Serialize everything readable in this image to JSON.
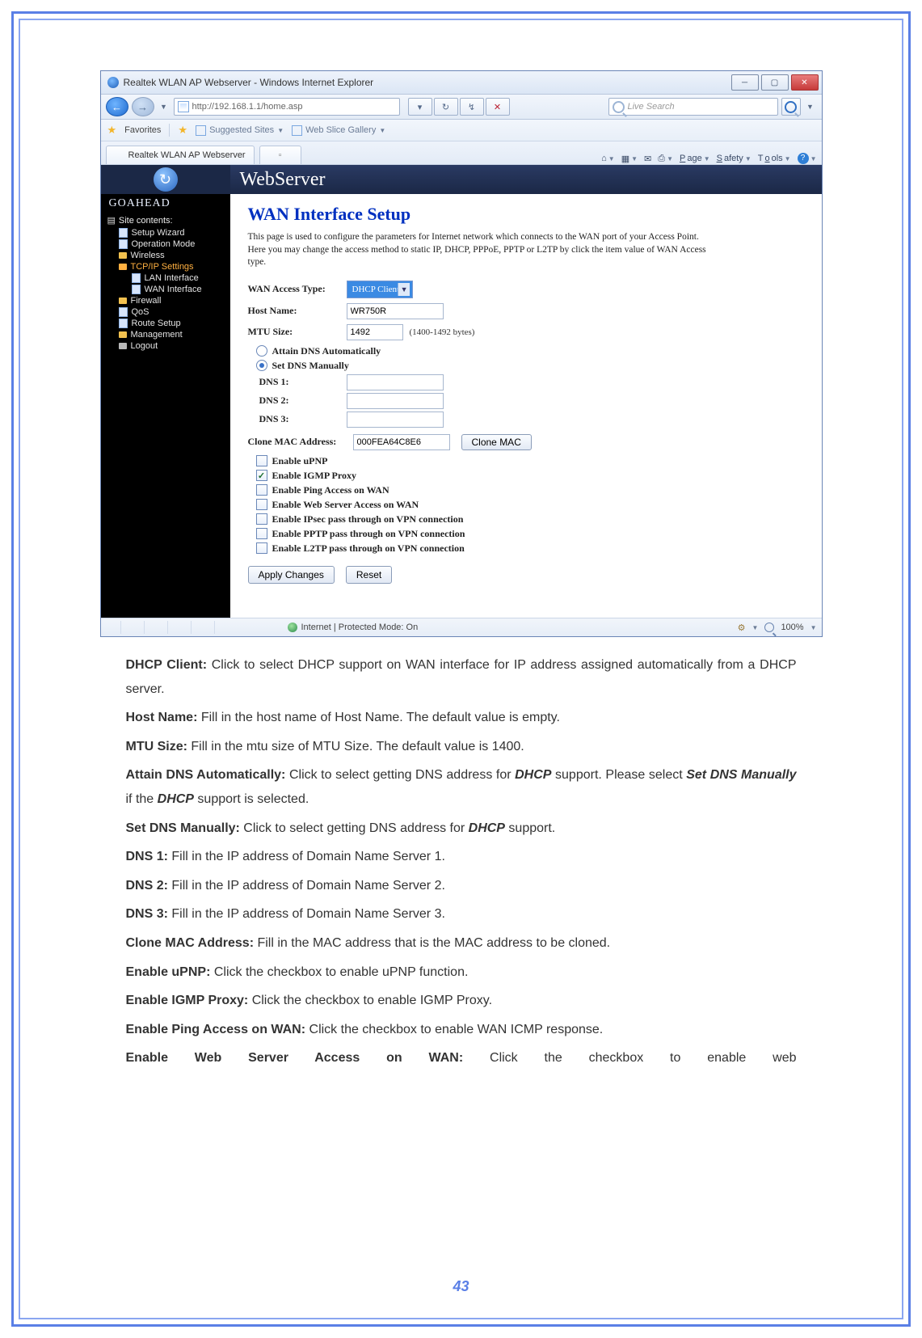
{
  "window": {
    "title": "Realtek WLAN AP Webserver - Windows Internet Explorer",
    "min_label": "─",
    "max_label": "▢",
    "close_label": "✕"
  },
  "addressbar": {
    "url": "http://192.168.1.1/home.asp",
    "search_placeholder": "Live Search"
  },
  "favbar": {
    "favorites": "Favorites",
    "suggested": "Suggested Sites",
    "webslice": "Web Slice Gallery"
  },
  "tabs": {
    "active": "Realtek WLAN AP Webserver"
  },
  "cmd": {
    "page": "Page",
    "safety": "Safety",
    "tools": "Tools"
  },
  "brand": {
    "webserver": "WebServer",
    "goahead": "GOAHEAD"
  },
  "sidebar": {
    "title": "Site contents:",
    "items": {
      "setup_wizard": "Setup Wizard",
      "operation_mode": "Operation Mode",
      "wireless": "Wireless",
      "tcpip": "TCP/IP Settings",
      "lan": "LAN Interface",
      "wan": "WAN Interface",
      "firewall": "Firewall",
      "qos": "QoS",
      "route": "Route Setup",
      "management": "Management",
      "logout": "Logout"
    }
  },
  "form": {
    "heading": "WAN Interface Setup",
    "description": "This page is used to configure the parameters for Internet network which connects to the WAN port of your Access Point. Here you may change the access method to static IP, DHCP, PPPoE, PPTP or L2TP by click the item value of WAN Access type.",
    "labels": {
      "wan_access_type": "WAN Access Type:",
      "host_name": "Host Name:",
      "mtu_size": "MTU Size:",
      "mtu_hint": "(1400-1492 bytes)",
      "attain_dns": "Attain DNS Automatically",
      "set_dns": "Set DNS Manually",
      "dns1": "DNS 1:",
      "dns2": "DNS 2:",
      "dns3": "DNS 3:",
      "clone_mac": "Clone MAC Address:",
      "clone_btn": "Clone MAC",
      "enable_upnp": "Enable uPNP",
      "enable_igmp": "Enable IGMP Proxy",
      "enable_ping": "Enable Ping Access on WAN",
      "enable_web": "Enable Web Server Access on WAN",
      "enable_ipsec": "Enable IPsec pass through on VPN connection",
      "enable_pptp": "Enable PPTP pass through on VPN connection",
      "enable_l2tp": "Enable L2TP pass through on VPN connection",
      "apply": "Apply Changes",
      "reset": "Reset"
    },
    "values": {
      "wan_access_type": "DHCP Client",
      "host_name": "WR750R",
      "mtu_size": "1492",
      "dns1": "",
      "dns2": "",
      "dns3": "",
      "clone_mac": "000FEA64C8E6",
      "igmp_checked": true,
      "dns_mode": "manual"
    }
  },
  "status": {
    "mode": "Internet | Protected Mode: On",
    "zoom": "100%"
  },
  "doc": {
    "p1a": "DHCP Client:",
    "p1b": " Click to select DHCP support on WAN interface for IP address assigned automatically from a DHCP server.",
    "p2a": "Host Name:",
    "p2b": " Fill in the host name of Host Name. The default value is empty.",
    "p3a": "MTU Size:",
    "p3b": " Fill in the mtu size of MTU Size. The default value is 1400.",
    "p4a": "Attain DNS Automatically:",
    "p4b_1": " Click to select getting DNS address for ",
    "p4b_dhcp": "DHCP",
    "p4b_2": " support. Please select ",
    "p4b_set": "Set DNS Manually",
    "p4b_3": " if the ",
    "p4b_dhcp2": "DHCP",
    "p4b_4": " support is selected.",
    "p5a": "Set DNS Manually:",
    "p5b_1": " Click to select getting DNS address for ",
    "p5b_dhcp": "DHCP",
    "p5b_2": " support.",
    "p6a": "DNS 1:",
    "p6b": " Fill in the IP address of Domain Name Server 1.",
    "p7a": "DNS 2:",
    "p7b": " Fill in the IP address of Domain Name Server 2.",
    "p8a": "DNS 3:",
    "p8b": " Fill in the IP address of Domain Name Server 3.",
    "p9a": "Clone MAC Address:",
    "p9b": " Fill in the MAC address that is the MAC address to be cloned.",
    "p10a": "Enable uPNP:",
    "p10b": " Click the checkbox to enable uPNP function.",
    "p11a": "Enable IGMP Proxy:",
    "p11b": " Click the checkbox to enable IGMP Proxy.",
    "p12a": "Enable Ping Access on WAN:",
    "p12b": " Click the checkbox to enable WAN ICMP response.",
    "p13a": "Enable Web Server Access on WAN:",
    "p13b": " Click the checkbox to enable web",
    "page_number": "43"
  }
}
